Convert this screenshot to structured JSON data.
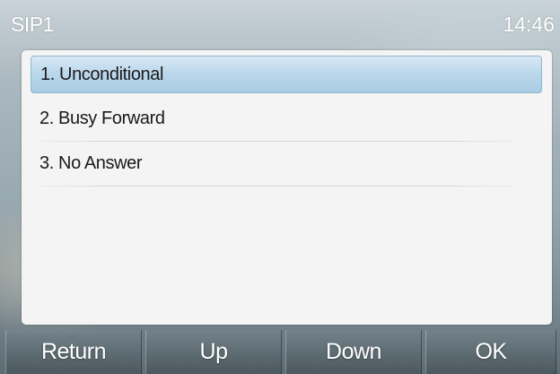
{
  "status_bar": {
    "account": "SIP1",
    "time": "14:46"
  },
  "menu": {
    "items": [
      {
        "label": "1. Unconditional",
        "selected": true
      },
      {
        "label": "2. Busy Forward",
        "selected": false
      },
      {
        "label": "3. No Answer",
        "selected": false
      }
    ]
  },
  "softkeys": {
    "return": "Return",
    "up": "Up",
    "down": "Down",
    "ok": "OK"
  },
  "colors": {
    "selection": "#b7d5ea",
    "panel": "#f4f4f4"
  }
}
